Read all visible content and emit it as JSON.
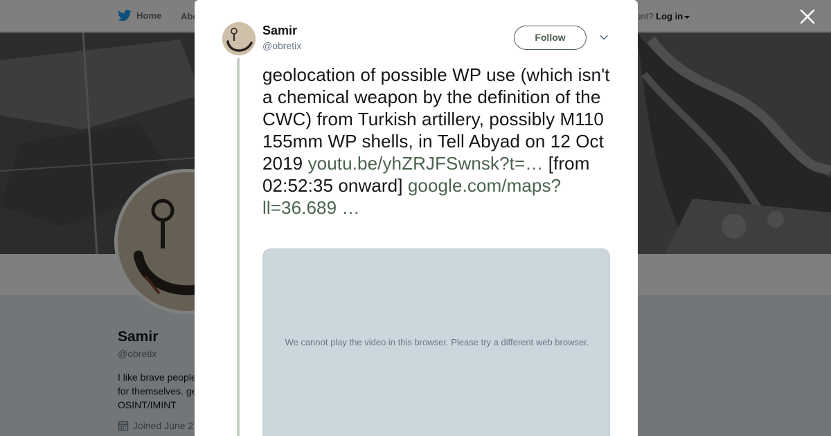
{
  "background_page": {
    "nav": {
      "home_label": "Home",
      "about_label": "Abo",
      "account_prompt": "ccount?",
      "login_label": "Log in"
    },
    "profile": {
      "name": "Samir",
      "handle": "@obretix",
      "bio_lines": [
        "I like brave people",
        "for themselves. ge",
        "OSINT/IMINT"
      ],
      "joined": "Joined June 2"
    }
  },
  "modal": {
    "author_name": "Samir",
    "author_handle": "@obretix",
    "follow_label": "Follow",
    "tweet": {
      "text_1": "geolocation of possible WP use (which isn't a chemical weapon by the definition of the CWC) from Turkish artillery, possibly M110 155mm WP shells, in Tell Abyad on 12 Oct 2019",
      "link_1": "youtu.be/yhZRJFSwnsk?t=…",
      "text_2": "[from 02:52:35 onward]",
      "link_2": "google.com/maps?ll=36.689 …"
    },
    "video_message": "We cannot play the video in this browser. Please try a different web browser."
  },
  "colors": {
    "link": "#4a634d",
    "thread_line": "#c6cfc5",
    "follow_border": "#4d5f50",
    "video_bg": "#ccd6dd"
  },
  "icons": [
    "twitter-bird-icon",
    "close-icon",
    "chevron-down-icon",
    "calendar-icon"
  ]
}
